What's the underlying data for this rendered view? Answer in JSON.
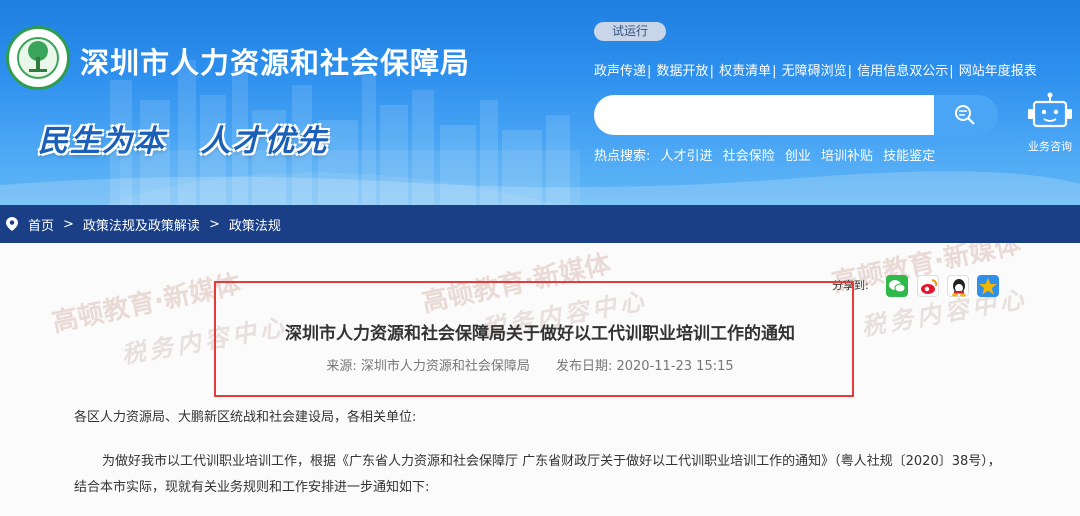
{
  "header": {
    "site_title": "深圳市人力资源和社会保障局",
    "slogan": [
      "民生为本",
      "人才优先"
    ],
    "trial_badge": "试运行",
    "top_nav": [
      "政声传递",
      "数据开放",
      "权责清单",
      "无障碍浏览",
      "信用信息双公示",
      "网站年度报表"
    ],
    "search": {
      "placeholder": ""
    },
    "hot_search": {
      "label": "热点搜索:",
      "keywords": [
        "人才引进",
        "社会保险",
        "创业",
        "培训补贴",
        "技能鉴定"
      ]
    },
    "robot_label": "业务咨询"
  },
  "breadcrumb": {
    "items": [
      "首页",
      "政策法规及政策解读",
      "政策法规"
    ]
  },
  "article": {
    "share_label": "分享到:",
    "title": "深圳市人力资源和社会保障局关于做好以工代训职业培训工作的通知",
    "source": "来源: 深圳市人力资源和社会保障局",
    "date": "发布日期: 2020-11-23 15:15",
    "salutation": "各区人力资源局、大鹏新区统战和社会建设局，各相关单位:",
    "body": "为做好我市以工代训职业培训工作，根据《广东省人力资源和社会保障厅 广东省财政厅关于做好以工代训职业培训工作的通知》（粤人社规〔2020〕38号），结合本市实际，现就有关业务规则和工作安排进一步通知如下:"
  },
  "watermark": {
    "line1": "高顿教育·新媒体",
    "line2": "税务内容中心"
  },
  "colors": {
    "header_blue": "#2d8fee",
    "breadcrumb_navy": "#1a3f86",
    "highlight_red": "#e53b3b",
    "wechat_green": "#2fb94a",
    "weibo_red": "#e6162d",
    "qq_blue": "#2f8fe9",
    "qzone_gold": "#f2b705"
  },
  "icons": [
    "gov-emblem-icon",
    "search-icon",
    "robot-icon",
    "location-pin-icon",
    "wechat-icon",
    "weibo-icon",
    "qq-icon",
    "qzone-icon"
  ]
}
